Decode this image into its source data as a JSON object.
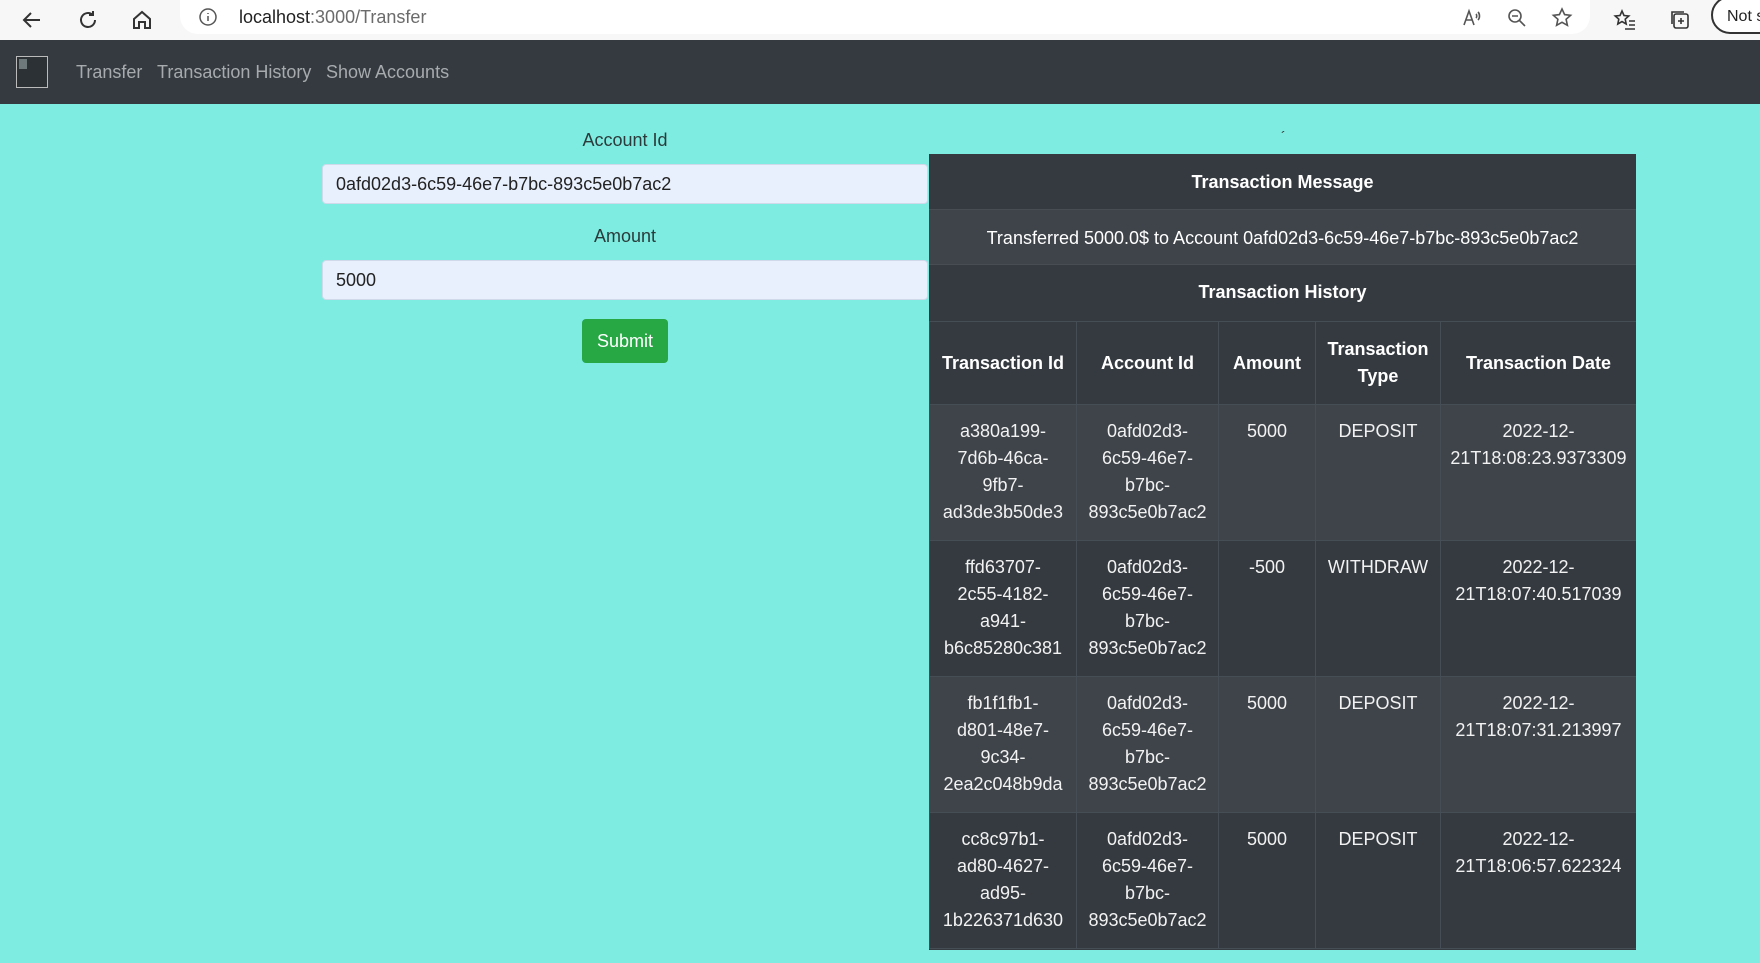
{
  "browser": {
    "url_host": "localhost",
    "url_path": ":3000/Transfer",
    "not_secure_label": "Not s"
  },
  "navbar": {
    "links": [
      "Transfer",
      "Transaction History",
      "Show Accounts"
    ]
  },
  "form": {
    "account_label": "Account Id",
    "account_value": "0afd02d3-6c59-46e7-b7bc-893c5e0b7ac2",
    "amount_label": "Amount",
    "amount_value": "5000",
    "submit_label": "Submit"
  },
  "stray_mark": "´",
  "panel": {
    "message_heading": "Transaction Message",
    "message": "Transferred 5000.0$ to Account 0afd02d3-6c59-46e7-b7bc-893c5e0b7ac2",
    "history_heading": "Transaction History",
    "columns": [
      "Transaction Id",
      "Account Id",
      "Amount",
      "Transaction Type",
      "Transaction Date"
    ],
    "rows": [
      {
        "id_lines": [
          "a380a199-",
          "7d6b-46ca-",
          "9fb7-",
          "ad3de3b50de3"
        ],
        "acct_lines": [
          "0afd02d3-",
          "6c59-46e7-",
          "b7bc-",
          "893c5e0b7ac2"
        ],
        "amount": "5000",
        "type": "DEPOSIT",
        "date_lines": [
          "2022-12-",
          "21T18:08:23.9373309"
        ]
      },
      {
        "id_lines": [
          "ffd63707-",
          "2c55-4182-",
          "a941-",
          "b6c85280c381"
        ],
        "acct_lines": [
          "0afd02d3-",
          "6c59-46e7-",
          "b7bc-",
          "893c5e0b7ac2"
        ],
        "amount": "-500",
        "type": "WITHDRAW",
        "date_lines": [
          "2022-12-",
          "21T18:07:40.517039"
        ]
      },
      {
        "id_lines": [
          "fb1f1fb1-",
          "d801-48e7-",
          "9c34-",
          "2ea2c048b9da"
        ],
        "acct_lines": [
          "0afd02d3-",
          "6c59-46e7-",
          "b7bc-",
          "893c5e0b7ac2"
        ],
        "amount": "5000",
        "type": "DEPOSIT",
        "date_lines": [
          "2022-12-",
          "21T18:07:31.213997"
        ]
      },
      {
        "id_lines": [
          "cc8c97b1-",
          "ad80-4627-",
          "ad95-",
          "1b226371d630"
        ],
        "acct_lines": [
          "0afd02d3-",
          "6c59-46e7-",
          "b7bc-",
          "893c5e0b7ac2"
        ],
        "amount": "5000",
        "type": "DEPOSIT",
        "date_lines": [
          "2022-12-",
          "21T18:06:57.622324"
        ]
      }
    ]
  },
  "icons": {
    "back": "back-arrow-icon",
    "refresh": "refresh-icon",
    "home": "home-icon",
    "info": "info-icon",
    "read_aloud": "read-aloud-icon",
    "zoom": "zoom-out-icon",
    "favorite_add": "add-favorite-icon",
    "favorites": "favorites-icon",
    "collections": "collections-icon"
  },
  "colors": {
    "background": "#7eece1",
    "navbar": "#343a40",
    "submit": "#28a745",
    "input_bg": "#e8effd"
  }
}
